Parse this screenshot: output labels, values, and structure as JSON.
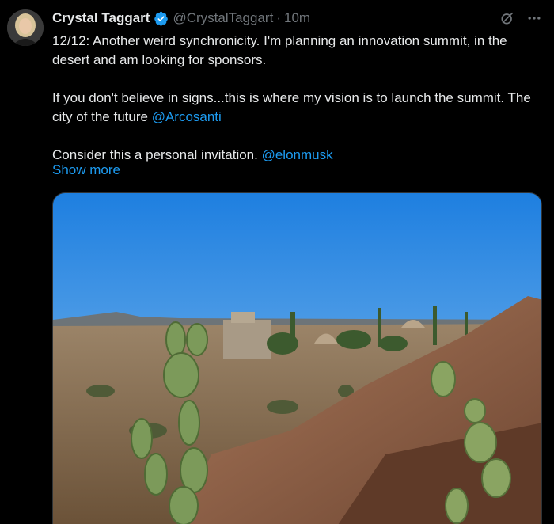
{
  "author": {
    "name": "Crystal Taggart",
    "handle": "@CrystalTaggart",
    "separator": "·",
    "time": "10m",
    "verified": true
  },
  "tweet": {
    "line1": "12/12: Another weird synchronicity. I'm planning an innovation summit, in the desert and am looking for sponsors.",
    "line2_text": "If you don't believe in signs...this is where my vision is to launch the summit. The city of the future ",
    "line2_mention": "@Arcosanti",
    "line3_text": "Consider this a personal invitation. ",
    "line3_mention": "@elonmusk",
    "show_more": "Show more"
  },
  "icons": {
    "grok": "grok-icon",
    "more": "more-icon",
    "verified": "verified-badge-icon"
  },
  "colors": {
    "background": "#000000",
    "text": "#e7e9ea",
    "muted": "#71767b",
    "accent": "#1d9bf0"
  }
}
